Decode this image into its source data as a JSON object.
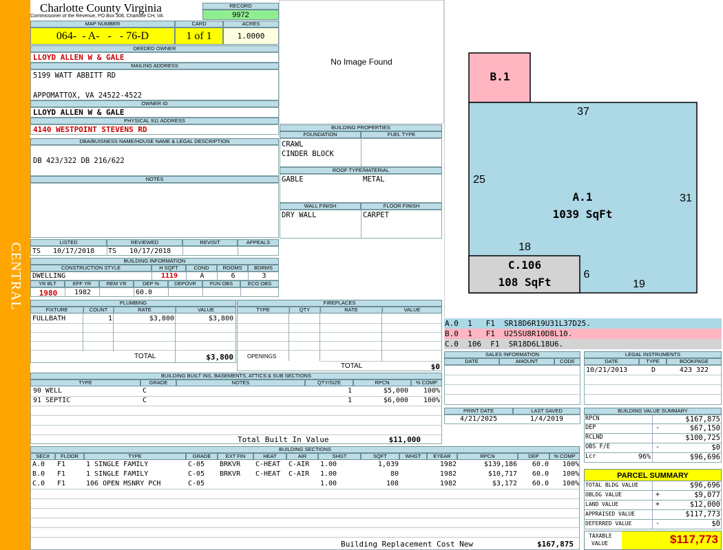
{
  "side_label": "CENTRAL",
  "colors": {
    "side_bar": "#ffa500",
    "header_bg": "#bcdde6",
    "yellow": "#ffff00",
    "green": "#90ee90",
    "pink": "#ffb6c1",
    "blue": "#add8e6",
    "grey": "#d3d3d3",
    "red": "#cc0000"
  },
  "county": {
    "title": "Charlotte County Virginia",
    "subtitle": "Commissioner of the Revenue, PO Box 308, Charlotte CH, VA"
  },
  "record": {
    "label": "RECORD",
    "value": "9972"
  },
  "map_number": {
    "label": "MAP NUMBER",
    "value": "064-  - A-   -   - 76-D"
  },
  "card": {
    "label": "CARD",
    "value": "1 of 1"
  },
  "acres": {
    "label": "ACRES",
    "value": "1.0000"
  },
  "deeded_owner": {
    "label": "DEEDED OWNER",
    "value": "LLOYD ALLEN W & GALE"
  },
  "mailing": {
    "label": "MAILING ADDRESS",
    "line1": "5199 WATT ABBITT RD",
    "line2": "APPOMATTOX, VA 24522-4522"
  },
  "owner_id": {
    "label": "OWNER ID",
    "value": "LLOYD ALLEN W & GALE"
  },
  "physical": {
    "label": "PHYSICAL 911 ADDRESS",
    "value": "4140 WESTPOINT STEVENS RD"
  },
  "dba": {
    "label": "DBA/BUISNESS NAME/HOUSE NAME & LEGAL DESCRIPTION",
    "value": "DB 423/322 DB 216/622"
  },
  "notes": {
    "label": "NOTES",
    "value": ""
  },
  "image": {
    "text": "No Image Found"
  },
  "building_properties": {
    "label": "BUILDING PROPERTIES",
    "foundation_label": "FOUNDATION",
    "fuel_label": "FUEL TYPE",
    "foundation1": "CRAWL",
    "foundation2": "CINDER BLOCK",
    "fuel": "",
    "roof_label": "ROOF TYPE/MATERIAL",
    "roof_type": "GABLE",
    "roof_material": "METAL",
    "wall_label": "WALL FINISH",
    "floor_label": "FLOOR FINISH",
    "wall": "DRY WALL",
    "floor": "CARPET"
  },
  "dates": {
    "listed_label": "LISTED",
    "reviewed_label": "REVIEWED",
    "revisit_label": "REVISIT",
    "appeals_label": "APPEALS",
    "listed_by": "TS",
    "listed": "10/17/2018",
    "reviewed_by": "TS",
    "reviewed": "10/17/2018",
    "revisit": "",
    "appeals": ""
  },
  "building_info": {
    "label": "BUILDING INFORMATION",
    "cs_label": "CONSTRUCTION STYLE",
    "hsqft_label": "H SQFT",
    "cond_label": "COND",
    "rooms_label": "ROOMS",
    "bdrms_label": "BDRMS",
    "style": "DWELLING",
    "hsqft": "1119",
    "cond": "A",
    "rooms": "6",
    "bdrms": "3",
    "yrblt_label": "YR BLT",
    "effyr_label": "EFF YR",
    "remyr_label": "REM YR",
    "dep_label": "DEP %",
    "depovr_label": "DEPOVR",
    "funobs_label": "FUN OBS",
    "ecoobs_label": "ECO OBS",
    "yrblt": "1980",
    "effyr": "1982",
    "remyr": "",
    "dep": "60.0",
    "depovr": "",
    "funobs": "",
    "ecoobs": ""
  },
  "plumbing": {
    "label": "PLUMBING",
    "headers": [
      "FIXTURE",
      "COUNT",
      "RATE",
      "VALUE"
    ],
    "rows": [
      [
        "FULLBATH",
        "1",
        "$3,800",
        "$3,800"
      ]
    ],
    "total_label": "TOTAL",
    "total": "$3,800"
  },
  "fireplaces": {
    "label": "FIREPLACES",
    "headers": [
      "TYPE",
      "QTY",
      "RATE",
      "VALUE"
    ],
    "openings_label": "OPENINGS",
    "total_label": "TOTAL",
    "total": "$0"
  },
  "builtins": {
    "label": "BUILDING BUILT INS, BASEMENTS, ATTICS & SUB SECTIONS",
    "headers": [
      "TYPE",
      "GRADE",
      "NOTES",
      "QTY/SIZE",
      "RPCN",
      "% COMP"
    ],
    "rows": [
      [
        "90 WELL",
        "C",
        "",
        "1",
        "$5,000",
        "100%"
      ],
      [
        "91 SEPTIC",
        "C",
        "",
        "1",
        "$6,000",
        "100%"
      ]
    ],
    "total_label": "Total Built In Value",
    "total": "$11,000"
  },
  "sketch": {
    "sections": [
      {
        "id": "B.1"
      },
      {
        "id": "A.1",
        "area": "1039 SqFt"
      },
      {
        "id": "C.106",
        "area": "108 SqFt"
      }
    ],
    "dims": [
      "37",
      "25",
      "31",
      "18",
      "6",
      "19"
    ]
  },
  "sketch_legend": [
    {
      "text": "A.0  1   F1  SR18D6R19U31L37D25.",
      "color": "#add8e6"
    },
    {
      "text": "B.0  1   F1  U25SU8R10D8L10.",
      "color": "#ffb6c1"
    },
    {
      "text": "C.0  106  F1  SR18D6L18U6.",
      "color": "#d3d3d3"
    }
  ],
  "sales": {
    "label": "SALES INFORMATION",
    "headers": [
      "DATE",
      "AMOUNT",
      "CODE"
    ]
  },
  "legal": {
    "label": "LEGAL INSTRUMENTS",
    "headers": [
      "DATE",
      "TYPE",
      "BOOKPAGE"
    ],
    "rows": [
      [
        "10/21/2013",
        "D",
        "423 322"
      ]
    ]
  },
  "print": {
    "print_label": "PRINT DATE",
    "saved_label": "LAST SAVED",
    "print_date": "4/21/2025",
    "last_saved": "1/4/2019"
  },
  "value_summary": {
    "label": "BUILDING VALUE SUMMARY",
    "rows": [
      {
        "k": "RPCN",
        "s": "",
        "v": "$167,875"
      },
      {
        "k": "DEP",
        "s": "-",
        "v": "$67,150"
      },
      {
        "k": "RCLND",
        "s": "",
        "v": "$100,725"
      },
      {
        "k": "OBS F/E",
        "s": "-",
        "v": "$0"
      },
      {
        "k": "Lcr",
        "p": "96%",
        "s": "",
        "v": "$96,696"
      }
    ]
  },
  "parcel": {
    "label": "PARCEL SUMMARY",
    "rows": [
      {
        "k": "TOTAL BLDG VALUE",
        "s": "",
        "v": "$96,696"
      },
      {
        "k": "OBLDG VALUE",
        "s": "+",
        "v": "$9,077"
      },
      {
        "k": "LAND VALUE",
        "s": "+",
        "v": "$12,000"
      },
      {
        "k": "APPRAISED VALUE",
        "s": "",
        "v": "$117,773"
      },
      {
        "k": "DEFERRED VALUE",
        "s": "-",
        "v": "$0"
      }
    ],
    "taxable_label1": "TAXABLE",
    "taxable_label2": "VALUE",
    "taxable": "$117,773"
  },
  "sections": {
    "label": "BUILDING SECTIONS",
    "headers": [
      "SEC#",
      "FLOOR",
      "TYPE",
      "GRADE",
      "EXT FIN",
      "HEAT",
      "AIR",
      "SHGT",
      "SQFT",
      "WHGT",
      "EYEAR",
      "RPCN",
      "DEP",
      "% COMP"
    ],
    "rows": [
      [
        "A.0",
        "F1",
        "1 SINGLE FAMILY",
        "C-05",
        "BRKVR",
        "C-HEAT",
        "C-AIR",
        "1.00",
        "1,039",
        "",
        "1982",
        "$139,186",
        "60.0",
        "100%"
      ],
      [
        "B.0",
        "F1",
        "1 SINGLE FAMILY",
        "C-05",
        "BRKVR",
        "C-HEAT",
        "C-AIR",
        "1.00",
        "80",
        "",
        "1982",
        "$10,717",
        "60.0",
        "100%"
      ],
      [
        "C.0",
        "F1",
        "106 OPEN MSNRY PCH",
        "C-05",
        "",
        "",
        "",
        "1.00",
        "108",
        "",
        "1982",
        "$3,172",
        "60.0",
        "100%"
      ]
    ],
    "total_label": "Building Replacement Cost New",
    "total": "$167,875"
  }
}
